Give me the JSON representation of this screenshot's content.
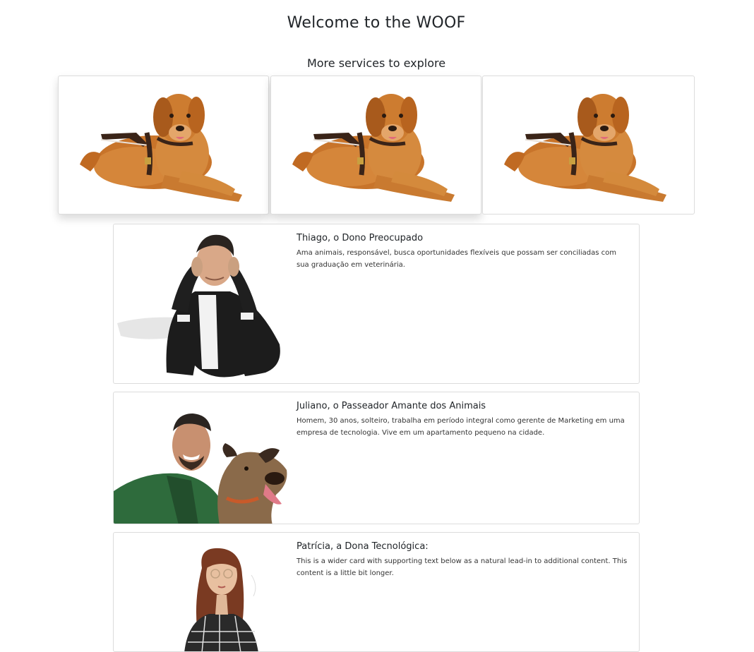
{
  "page": {
    "title": "Welcome to the WOOF",
    "services_title": "More services to explore"
  },
  "services": [
    {
      "image": "golden-retriever-guide-dog"
    },
    {
      "image": "golden-retriever-guide-dog"
    },
    {
      "image": "golden-retriever-guide-dog"
    }
  ],
  "personas": [
    {
      "title": "Thiago, o Dono Preocupado",
      "text": "Ama animais, responsável, busca oportunidades flexíveis que possam ser conciliadas com sua graduação em veterinária.",
      "image": "worried-man-photo"
    },
    {
      "title": "Juliano, o Passeador Amante dos Animais",
      "text": "Homem, 30 anos, solteiro, trabalha em período integral como gerente de Marketing em uma empresa de tecnologia. Vive em um apartamento pequeno na cidade.",
      "image": "man-with-dog-photo"
    },
    {
      "title": "Patrícia, a Dona Tecnológica:",
      "text": "This is a wider card with supporting text below as a natural lead-in to additional content. This content is a little bit longer.",
      "image": "woman-with-glasses-photo"
    }
  ],
  "colors": {
    "text": "#212529",
    "border": "#dcdcdc",
    "dog_fur": "#c8742a"
  }
}
